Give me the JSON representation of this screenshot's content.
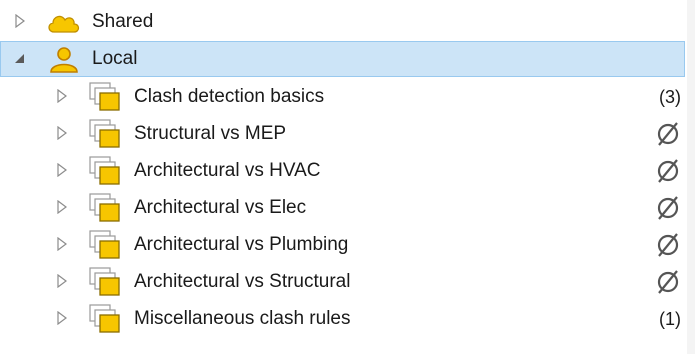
{
  "tree": {
    "roots": [
      {
        "label": "Shared",
        "icon": "cloud-icon",
        "expanded": false,
        "selected": false
      },
      {
        "label": "Local",
        "icon": "user-icon",
        "expanded": true,
        "selected": true
      }
    ],
    "children": [
      {
        "label": "Clash detection basics",
        "icon": "rule-folder-icon",
        "count": "(3)",
        "status": ""
      },
      {
        "label": "Structural vs MEP",
        "icon": "rule-folder-icon",
        "count": "",
        "status": "empty-set-icon"
      },
      {
        "label": "Architectural vs HVAC",
        "icon": "rule-folder-icon",
        "count": "",
        "status": "empty-set-icon"
      },
      {
        "label": "Architectural vs Elec",
        "icon": "rule-folder-icon",
        "count": "",
        "status": "empty-set-icon"
      },
      {
        "label": "Architectural vs Plumbing",
        "icon": "rule-folder-icon",
        "count": "",
        "status": "empty-set-icon"
      },
      {
        "label": "Architectural vs Structural",
        "icon": "rule-folder-icon",
        "count": "",
        "status": "empty-set-icon"
      },
      {
        "label": "Miscellaneous clash rules",
        "icon": "rule-folder-icon",
        "count": "(1)",
        "status": ""
      }
    ]
  },
  "colors": {
    "selection_bg": "#cce4f7",
    "selection_border": "#99c9ef",
    "folder_yellow": "#f7c600",
    "folder_outline": "#8a6d00",
    "user_orange": "#e8a317"
  }
}
